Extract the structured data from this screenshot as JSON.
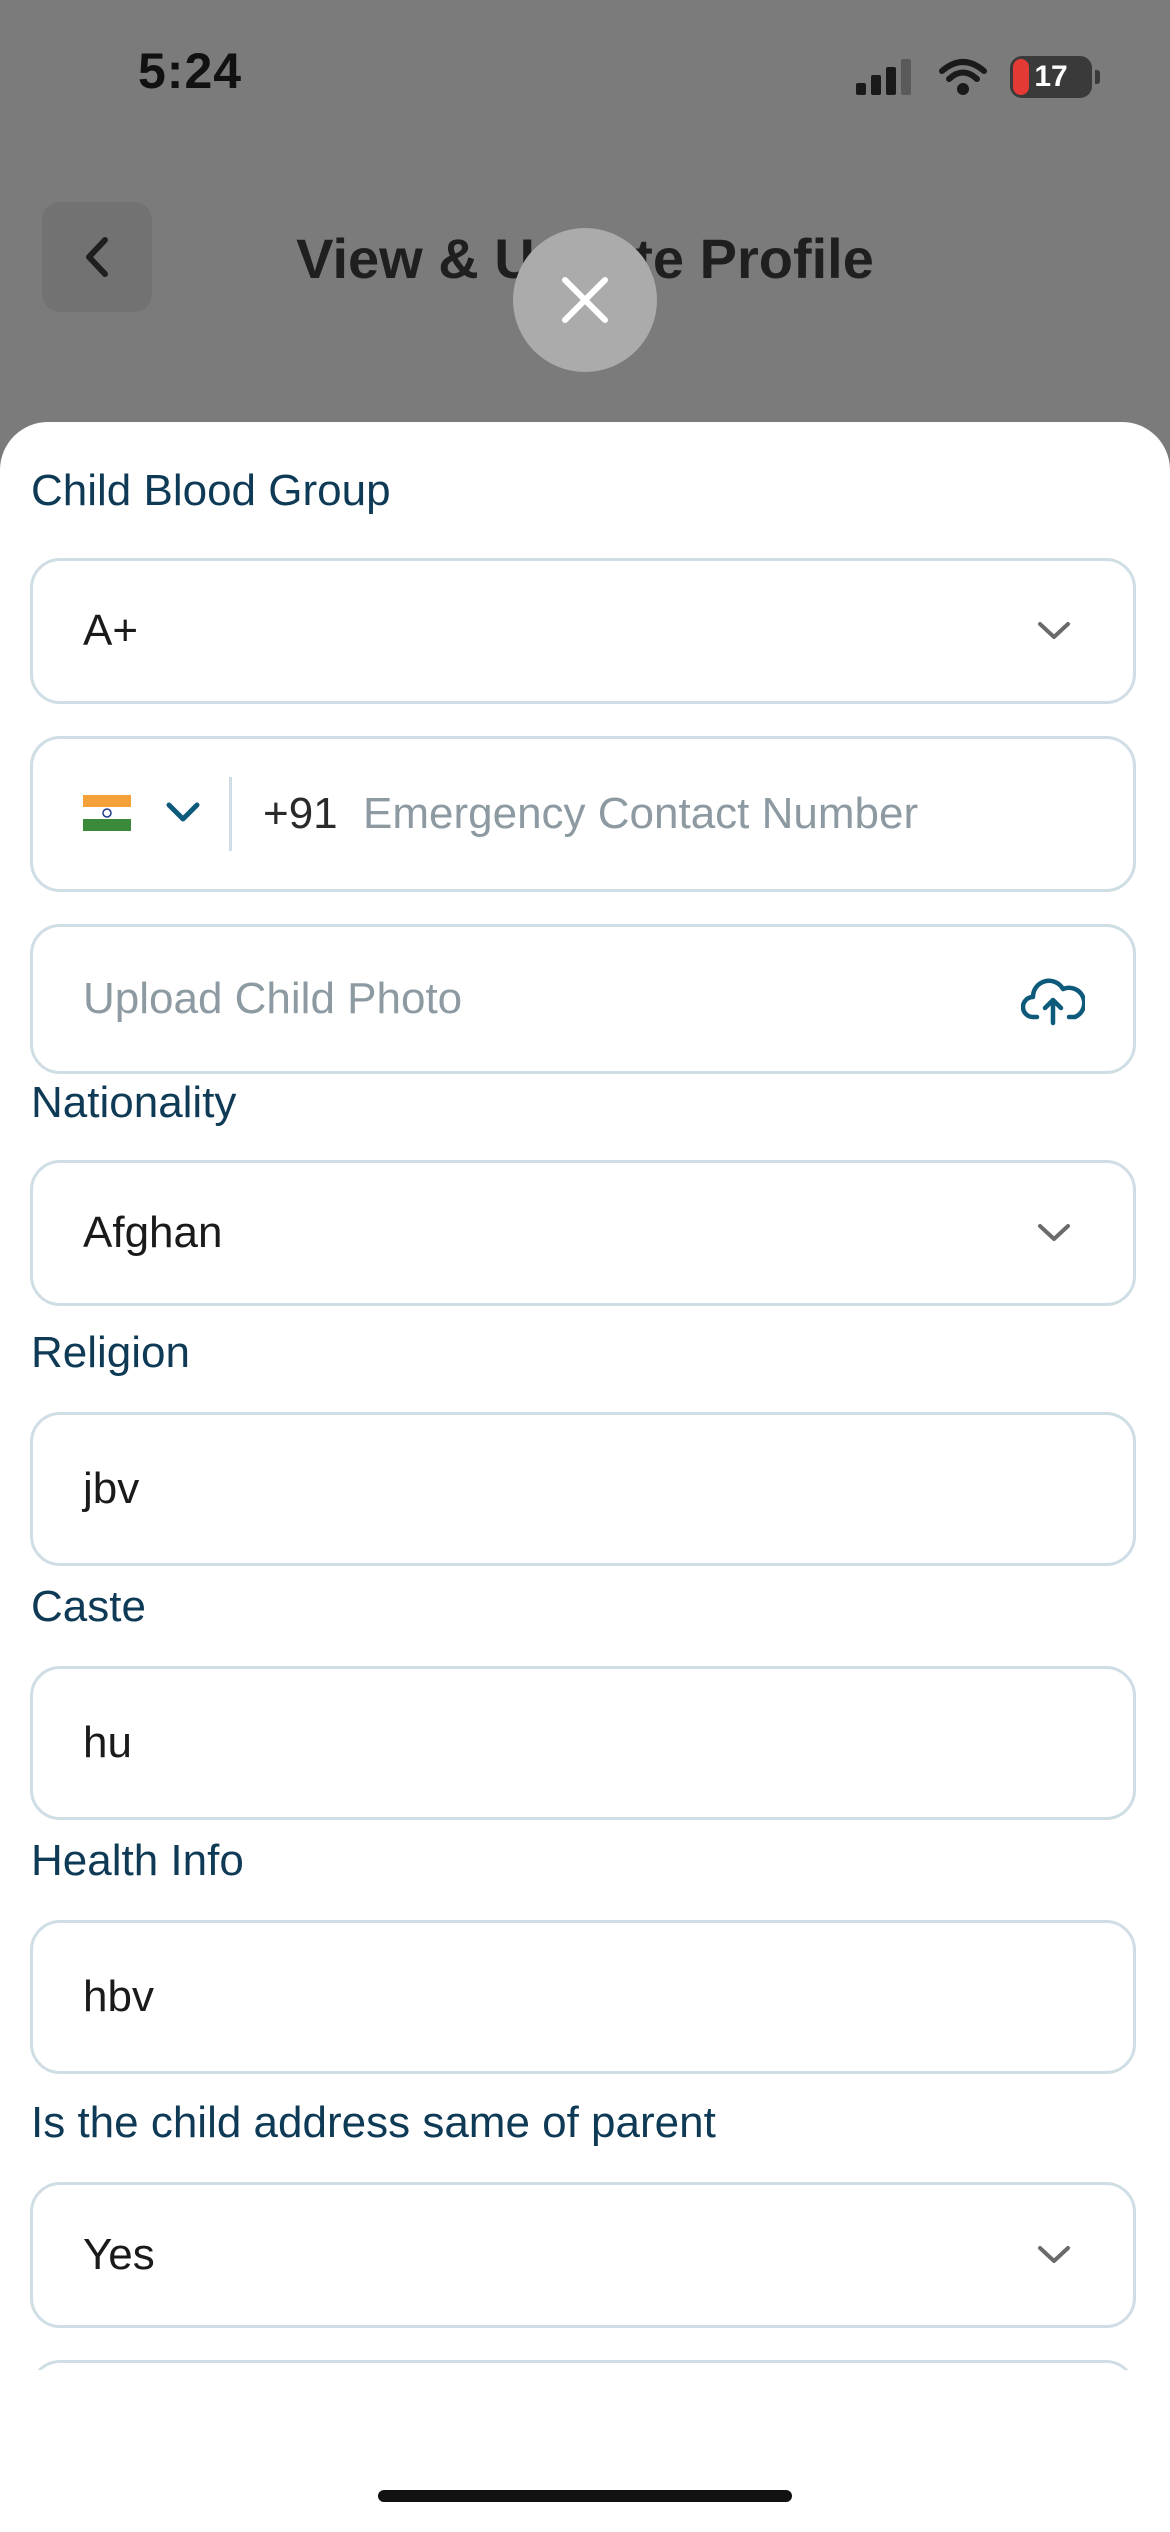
{
  "status_bar": {
    "time": "5:24",
    "battery": "17"
  },
  "header": {
    "title": "View & Update Profile"
  },
  "form": {
    "blood_group": {
      "label": "Child Blood Group",
      "value": "A+"
    },
    "emergency": {
      "country_code": "+91",
      "placeholder": "Emergency Contact Number"
    },
    "photo": {
      "placeholder": "Upload Child Photo"
    },
    "nationality": {
      "label": "Nationality",
      "value": "Afghan"
    },
    "religion": {
      "label": "Religion",
      "value": "jbv"
    },
    "caste": {
      "label": "Caste",
      "value": "hu"
    },
    "health": {
      "label": "Health Info",
      "value": "hbv"
    },
    "address_same": {
      "label": "Is the child address same of parent",
      "value": "Yes"
    }
  },
  "colors": {
    "label": "#0e3a56",
    "border": "#cfdde4",
    "placeholder": "#8d9aa2",
    "icon": "#0e5a7a"
  }
}
